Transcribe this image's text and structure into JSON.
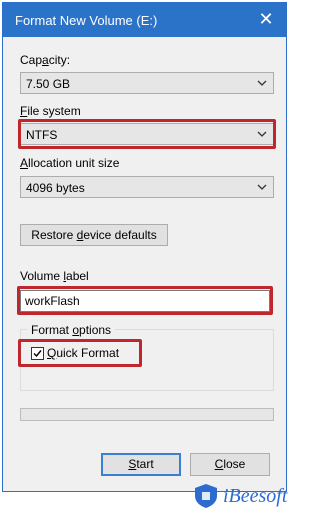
{
  "window": {
    "title": "Format New Volume (E:)",
    "close_glyph": "✕"
  },
  "capacity": {
    "label_prefix": "Cap",
    "label_mnemonic": "a",
    "label_suffix": "city:",
    "value": "7.50 GB"
  },
  "file_system": {
    "label_mnemonic": "F",
    "label_suffix": "ile system",
    "value": "NTFS"
  },
  "allocation": {
    "label_mnemonic": "A",
    "label_suffix": "llocation unit size",
    "value": "4096 bytes"
  },
  "restore_button": {
    "prefix": "Restore ",
    "mnemonic": "d",
    "suffix": "evice defaults"
  },
  "volume_label": {
    "label_prefix": "Volume ",
    "label_mnemonic": "l",
    "label_suffix": "abel",
    "value": "workFlash"
  },
  "format_options": {
    "title_prefix": "Format ",
    "title_mnemonic": "o",
    "title_suffix": "ptions"
  },
  "quick_format": {
    "checked": true,
    "check_glyph": "✓",
    "label_mnemonic": "Q",
    "label_suffix": "uick Format"
  },
  "progress": {
    "fraction": 0.0
  },
  "buttons": {
    "start": {
      "mnemonic": "S",
      "suffix": "tart"
    },
    "close": {
      "mnemonic": "C",
      "suffix": "lose"
    }
  },
  "watermark": {
    "brand": "iBeesoft"
  },
  "colors": {
    "titlebar": "#2b73c9",
    "highlight": "#c0272d",
    "brand": "#2d6bd0"
  },
  "icons": {
    "chevron": "chevron-down-icon",
    "close": "close-icon",
    "check": "checkmark-icon",
    "logo": "ibeesoft-shield-logo"
  }
}
